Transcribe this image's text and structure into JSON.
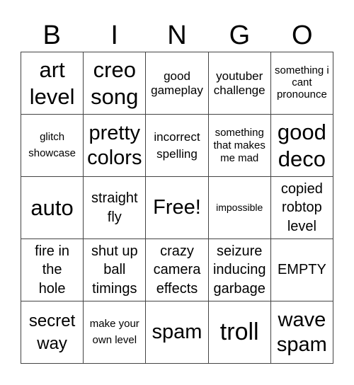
{
  "header": {
    "letters": [
      "B",
      "I",
      "N",
      "G",
      "O"
    ]
  },
  "cells": [
    [
      "art level",
      "creo song",
      "good gameplay",
      "youtuber challenge",
      "something i cant pronounce"
    ],
    [
      "glitch showcase",
      "pretty colors",
      "incorrect spelling",
      "something that makes me mad",
      "good deco"
    ],
    [
      "auto",
      "straight fly",
      "Free!",
      "impossible",
      "copied robtop level"
    ],
    [
      "fire in the hole",
      "shut up ball timings",
      "crazy camera effects",
      "seizure inducing garbage",
      "EMPTY"
    ],
    [
      "secret way",
      "make your own level",
      "spam",
      "troll",
      "wave spam"
    ]
  ]
}
